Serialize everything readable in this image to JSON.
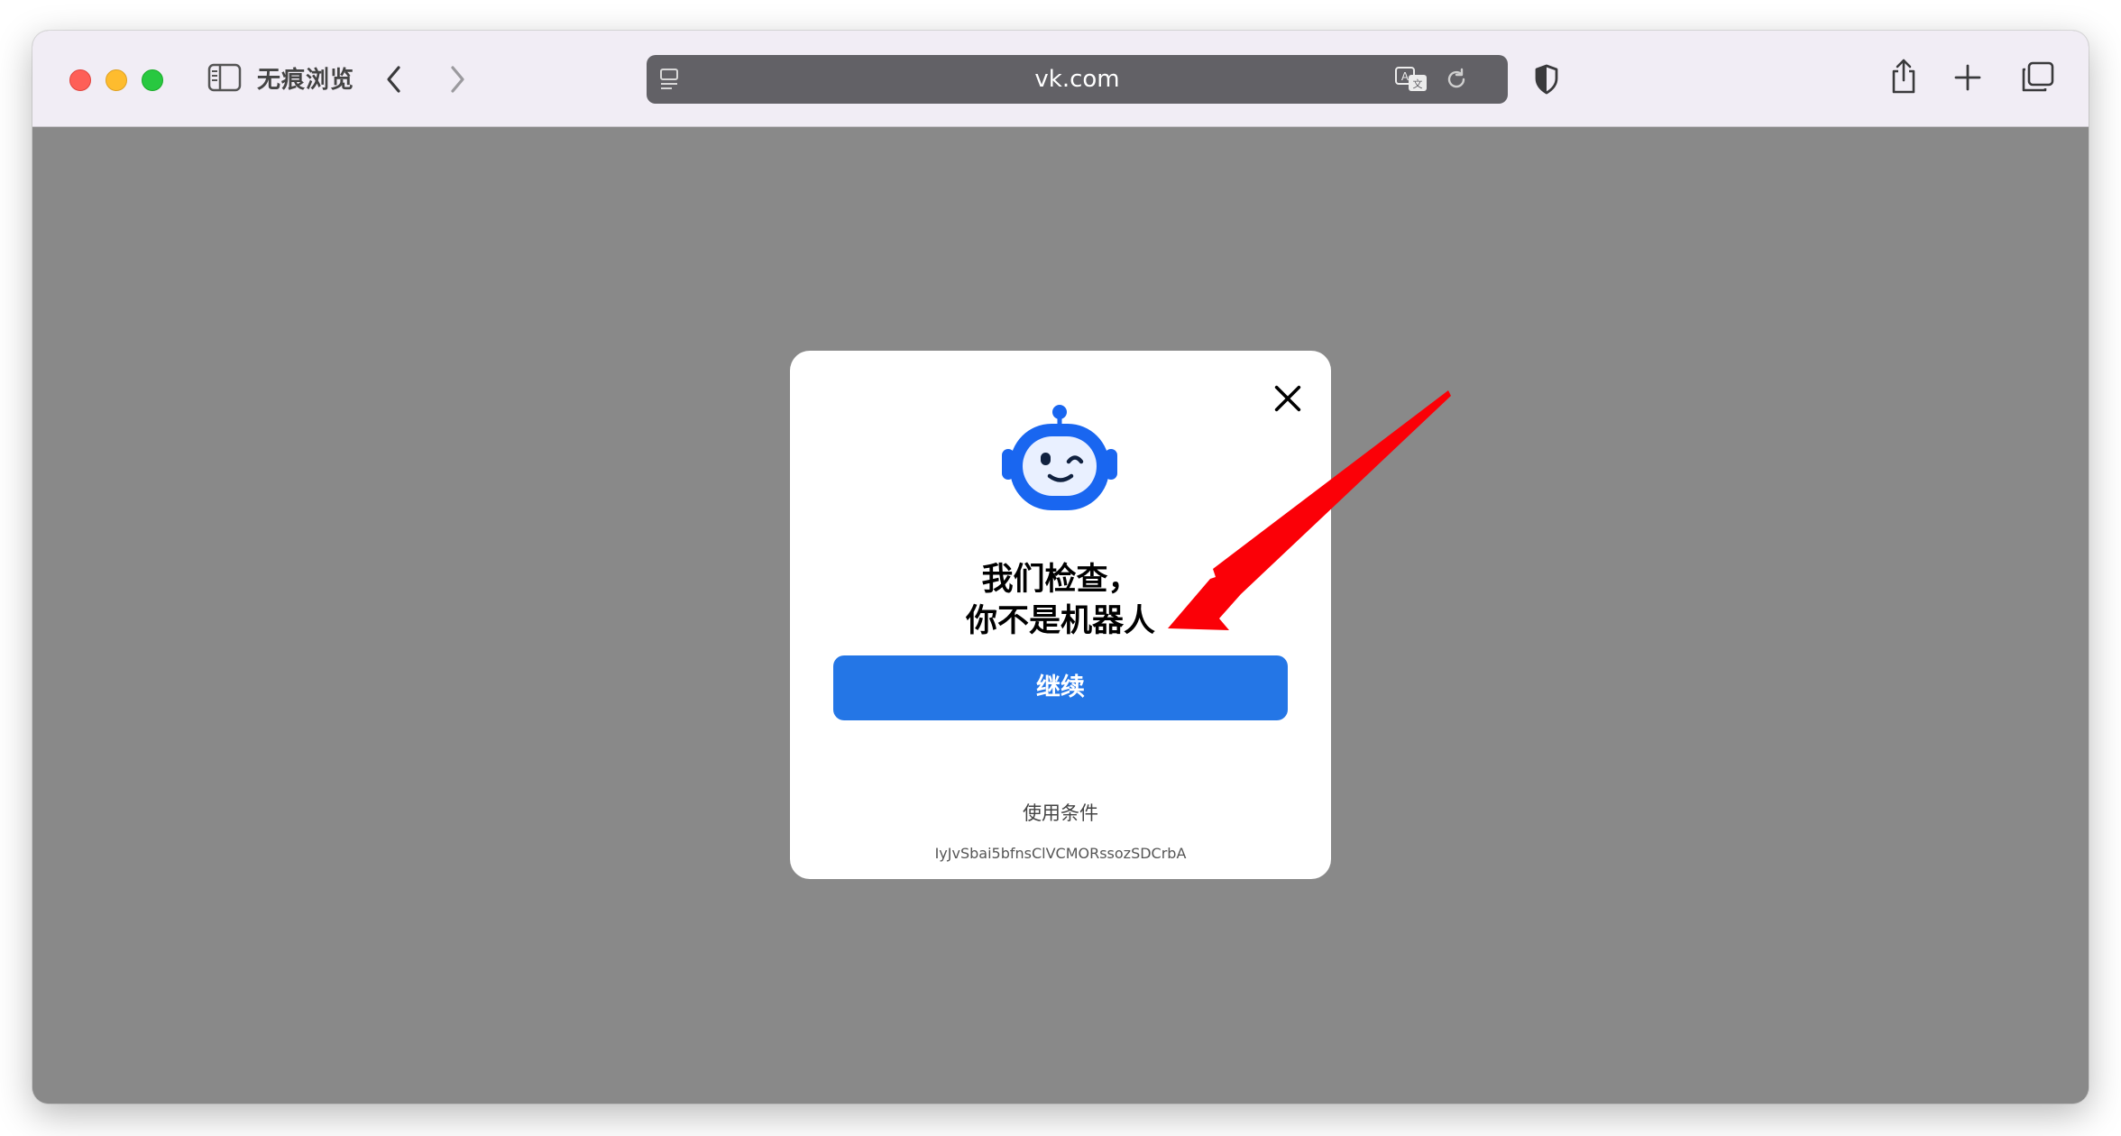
{
  "browser": {
    "window_controls": [
      "close",
      "minimize",
      "zoom"
    ],
    "private_label": "无痕浏览",
    "url": "vk.com",
    "icons": {
      "sidebar": "sidebar-toggle-icon",
      "back": "chevron-left-icon",
      "forward": "chevron-right-icon",
      "reader": "reader-icon",
      "translate": "translate-icon",
      "reload": "reload-icon",
      "privacy": "shield-icon",
      "share": "share-icon",
      "new_tab": "plus-icon",
      "tabs": "tab-overview-icon"
    }
  },
  "dialog": {
    "title_line1": "我们检查，",
    "title_line2": "你不是机器人",
    "continue_label": "继续",
    "terms_link": "使用条件",
    "token": "IyJvSbai5bfnsClVCMORssozSDCrbA",
    "mascot_icon": "robot-icon",
    "close_icon": "close-icon"
  },
  "annotation": {
    "arrow_icon": "red-arrow-icon",
    "arrow_color": "#fb0007"
  },
  "colors": {
    "accent": "#2476e6",
    "page_overlay": "#898989",
    "toolbar": "#f1edf5"
  }
}
